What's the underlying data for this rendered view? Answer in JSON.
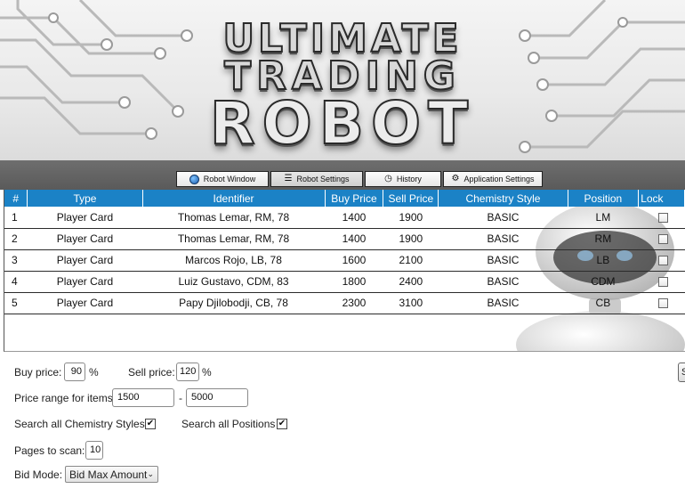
{
  "logo": {
    "line1": "ULTIMATE",
    "line2": "TRADING",
    "line3": "ROBOT"
  },
  "tabs": [
    {
      "label": "Robot Window",
      "icon": "globe-icon"
    },
    {
      "label": "Robot Settings",
      "icon": "list-icon",
      "active": true
    },
    {
      "label": "History",
      "icon": "clock-icon"
    },
    {
      "label": "Application Settings",
      "icon": "gear-icon"
    }
  ],
  "table": {
    "headers": [
      "#",
      "Type",
      "Identifier",
      "Buy Price",
      "Sell Price",
      "Chemistry Style",
      "Position",
      "Lock"
    ],
    "rows": [
      [
        "1",
        "Player Card",
        "Thomas Lemar, RM, 78",
        "1400",
        "1900",
        "BASIC",
        "LM"
      ],
      [
        "2",
        "Player Card",
        "Thomas Lemar, RM, 78",
        "1400",
        "1900",
        "BASIC",
        "RM"
      ],
      [
        "3",
        "Player Card",
        "Marcos Rojo, LB, 78",
        "1600",
        "2100",
        "BASIC",
        "LB"
      ],
      [
        "4",
        "Player Card",
        "Luiz Gustavo, CDM, 83",
        "1800",
        "2400",
        "BASIC",
        "CDM"
      ],
      [
        "5",
        "Player Card",
        "Papy Djilobodji, CB, 78",
        "2300",
        "3100",
        "BASIC",
        "CB"
      ]
    ]
  },
  "settings": {
    "buy_price_label": "Buy price:",
    "buy_price_value": "90",
    "percent": "%",
    "sell_price_label": "Sell price:",
    "sell_price_value": "120",
    "price_range_label": "Price range for items",
    "price_range_min": "1500",
    "price_range_dash": "-",
    "price_range_max": "5000",
    "search_chem_label": "Search all Chemistry Styles",
    "search_chem_checked": "✔",
    "search_pos_label": "Search all Positions",
    "search_pos_checked": "✔",
    "pages_label": "Pages to scan:",
    "pages_value": "10",
    "bid_mode_label": "Bid Mode:",
    "bid_mode_value": "Bid Max Amount",
    "side_button_label": "S"
  }
}
